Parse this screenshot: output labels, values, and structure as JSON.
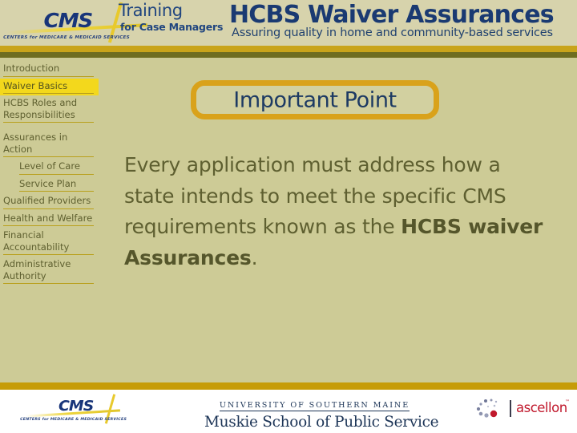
{
  "header": {
    "cms_wordmark": "CMS",
    "cms_sub": "CENTERS for MEDICARE & MEDICAID SERVICES",
    "training": "Training",
    "training_sub": "for Case Managers",
    "title": "HCBS Waiver Assurances",
    "subtitle": "Assuring quality in home and community-based services",
    "title_color": "#1a3a72"
  },
  "sidebar": {
    "items": [
      {
        "label": "Introduction",
        "active": false,
        "sub": false
      },
      {
        "label": "Waiver Basics",
        "active": true,
        "sub": false
      },
      {
        "label": "HCBS Roles and Responsibilities",
        "active": false,
        "sub": false
      },
      {
        "label": "Assurances in Action",
        "active": false,
        "sub": false
      },
      {
        "label": "Level of Care",
        "active": false,
        "sub": true
      },
      {
        "label": "Service Plan",
        "active": false,
        "sub": true
      },
      {
        "label": "Qualified Providers",
        "active": false,
        "sub": false
      },
      {
        "label": "Health and Welfare",
        "active": false,
        "sub": false
      },
      {
        "label": "Financial Accountability",
        "active": false,
        "sub": false
      },
      {
        "label": "Administrative Authority",
        "active": false,
        "sub": false
      }
    ],
    "active_highlight_color": "#f3d81c",
    "rule_color": "#b9a01c",
    "text_color": "#5f6030"
  },
  "main": {
    "banner_title": "Important Point",
    "banner_border_color": "#d9a21b",
    "body_part_1": "Every application must address how a state intends to meet the specific CMS requirements known as the ",
    "body_bold": "HCBS waiver Assurances",
    "body_part_2": ".",
    "body_text_color": "#5e5f30"
  },
  "footer": {
    "cms_wordmark": "CMS",
    "cms_sub": "CENTERS for MEDICARE & MEDICAID SERVICES",
    "university": "UNIVERSITY OF SOUTHERN MAINE",
    "school": "Muskie School of Public Service",
    "partner": "ascellon",
    "partner_tm": "™",
    "partner_color": "#c0182c",
    "rule_color": "#c69c08"
  },
  "theme": {
    "page_background": "#cdcb96",
    "header_background": "#d7d3ac",
    "gold_rule": "#c9a41a",
    "olive_rule": "#6e6d20"
  }
}
